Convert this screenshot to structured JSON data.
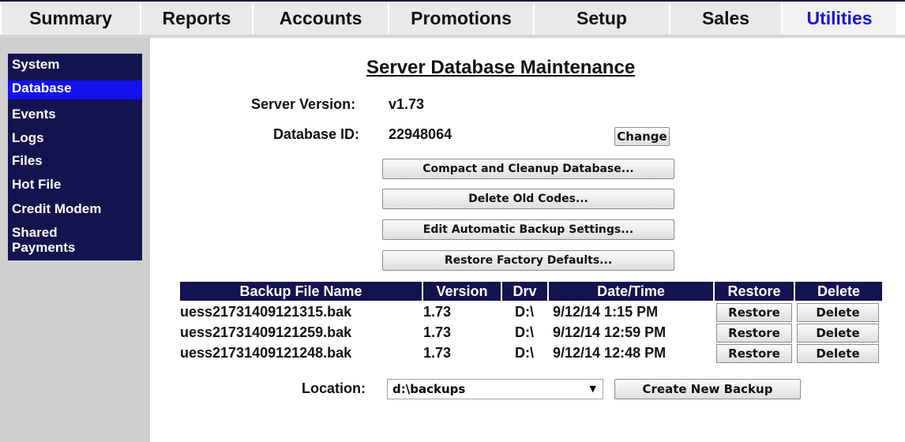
{
  "top_tabs": [
    {
      "label": "Summary"
    },
    {
      "label": "Reports"
    },
    {
      "label": "Accounts"
    },
    {
      "label": "Promotions"
    },
    {
      "label": "Setup"
    },
    {
      "label": "Sales"
    },
    {
      "label": "Utilities",
      "active": true
    }
  ],
  "sidebar": {
    "items": [
      {
        "label": "System"
      },
      {
        "label": "Database",
        "active": true
      },
      {
        "label": "Events"
      },
      {
        "label": "Logs"
      },
      {
        "label": "Files"
      },
      {
        "label": "Hot File"
      },
      {
        "label": "Credit Modem"
      },
      {
        "label": "Shared"
      },
      {
        "label": "Payments"
      }
    ]
  },
  "page": {
    "title": "Server Database Maintenance",
    "server_version_label": "Server Version:",
    "server_version_value": "v1.73",
    "database_id_label": "Database ID:",
    "database_id_value": "22948064",
    "change_button": "Change",
    "actions": {
      "compact": "Compact and Cleanup Database...",
      "delete_old": "Delete Old Codes...",
      "backup_settings": "Edit Automatic Backup Settings...",
      "restore_defaults": "Restore Factory Defaults..."
    }
  },
  "backups": {
    "headers": {
      "file": "Backup File Name",
      "version": "Version",
      "drive": "Drv",
      "datetime": "Date/Time",
      "restore": "Restore",
      "delete": "Delete"
    },
    "rows": [
      {
        "file": "uess21731409121315.bak",
        "version": "1.73",
        "drive": "D:\\",
        "datetime": "9/12/14 1:15 PM",
        "restore": "Restore",
        "delete": "Delete"
      },
      {
        "file": "uess21731409121259.bak",
        "version": "1.73",
        "drive": "D:\\",
        "datetime": "9/12/14 12:59 PM",
        "restore": "Restore",
        "delete": "Delete"
      },
      {
        "file": "uess21731409121248.bak",
        "version": "1.73",
        "drive": "D:\\",
        "datetime": "9/12/14 12:48 PM",
        "restore": "Restore",
        "delete": "Delete"
      }
    ]
  },
  "location": {
    "label": "Location:",
    "selected": "d:\\backups",
    "dropdown_icon": "triangle-down-icon",
    "create_button": "Create New Backup"
  }
}
